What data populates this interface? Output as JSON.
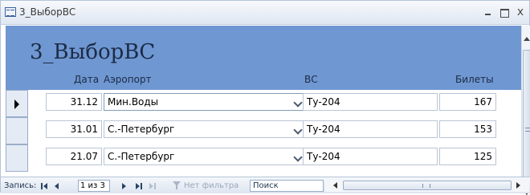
{
  "window": {
    "title": "3_ВыборВС",
    "icon": "form-icon",
    "controls": [
      "minimize-icon",
      "maximize-icon",
      "close-icon"
    ],
    "close_glyph": "x"
  },
  "form": {
    "title": "3_ВыборВС",
    "header_color": "#6f97d2",
    "columns": {
      "date": "Дата",
      "airport": "Аэропорт",
      "aircraft": "ВС",
      "tickets": "Билеты"
    },
    "rows": [
      {
        "date": "31.12",
        "airport": "Мин.Воды",
        "aircraft": "Ту-204",
        "tickets": "167",
        "current": true
      },
      {
        "date": "31.01",
        "airport": "С.-Петербург",
        "aircraft": "Ту-204",
        "tickets": "153",
        "current": false
      },
      {
        "date": "21.07",
        "airport": "С.-Петербург",
        "aircraft": "Ту-204",
        "tickets": "125",
        "current": false
      }
    ]
  },
  "navbar": {
    "record_label": "Запись:",
    "record_position": "1 из 3",
    "filter_label": "Нет фильтра",
    "search_placeholder": "Поиск",
    "hscroll_grip": "III"
  }
}
